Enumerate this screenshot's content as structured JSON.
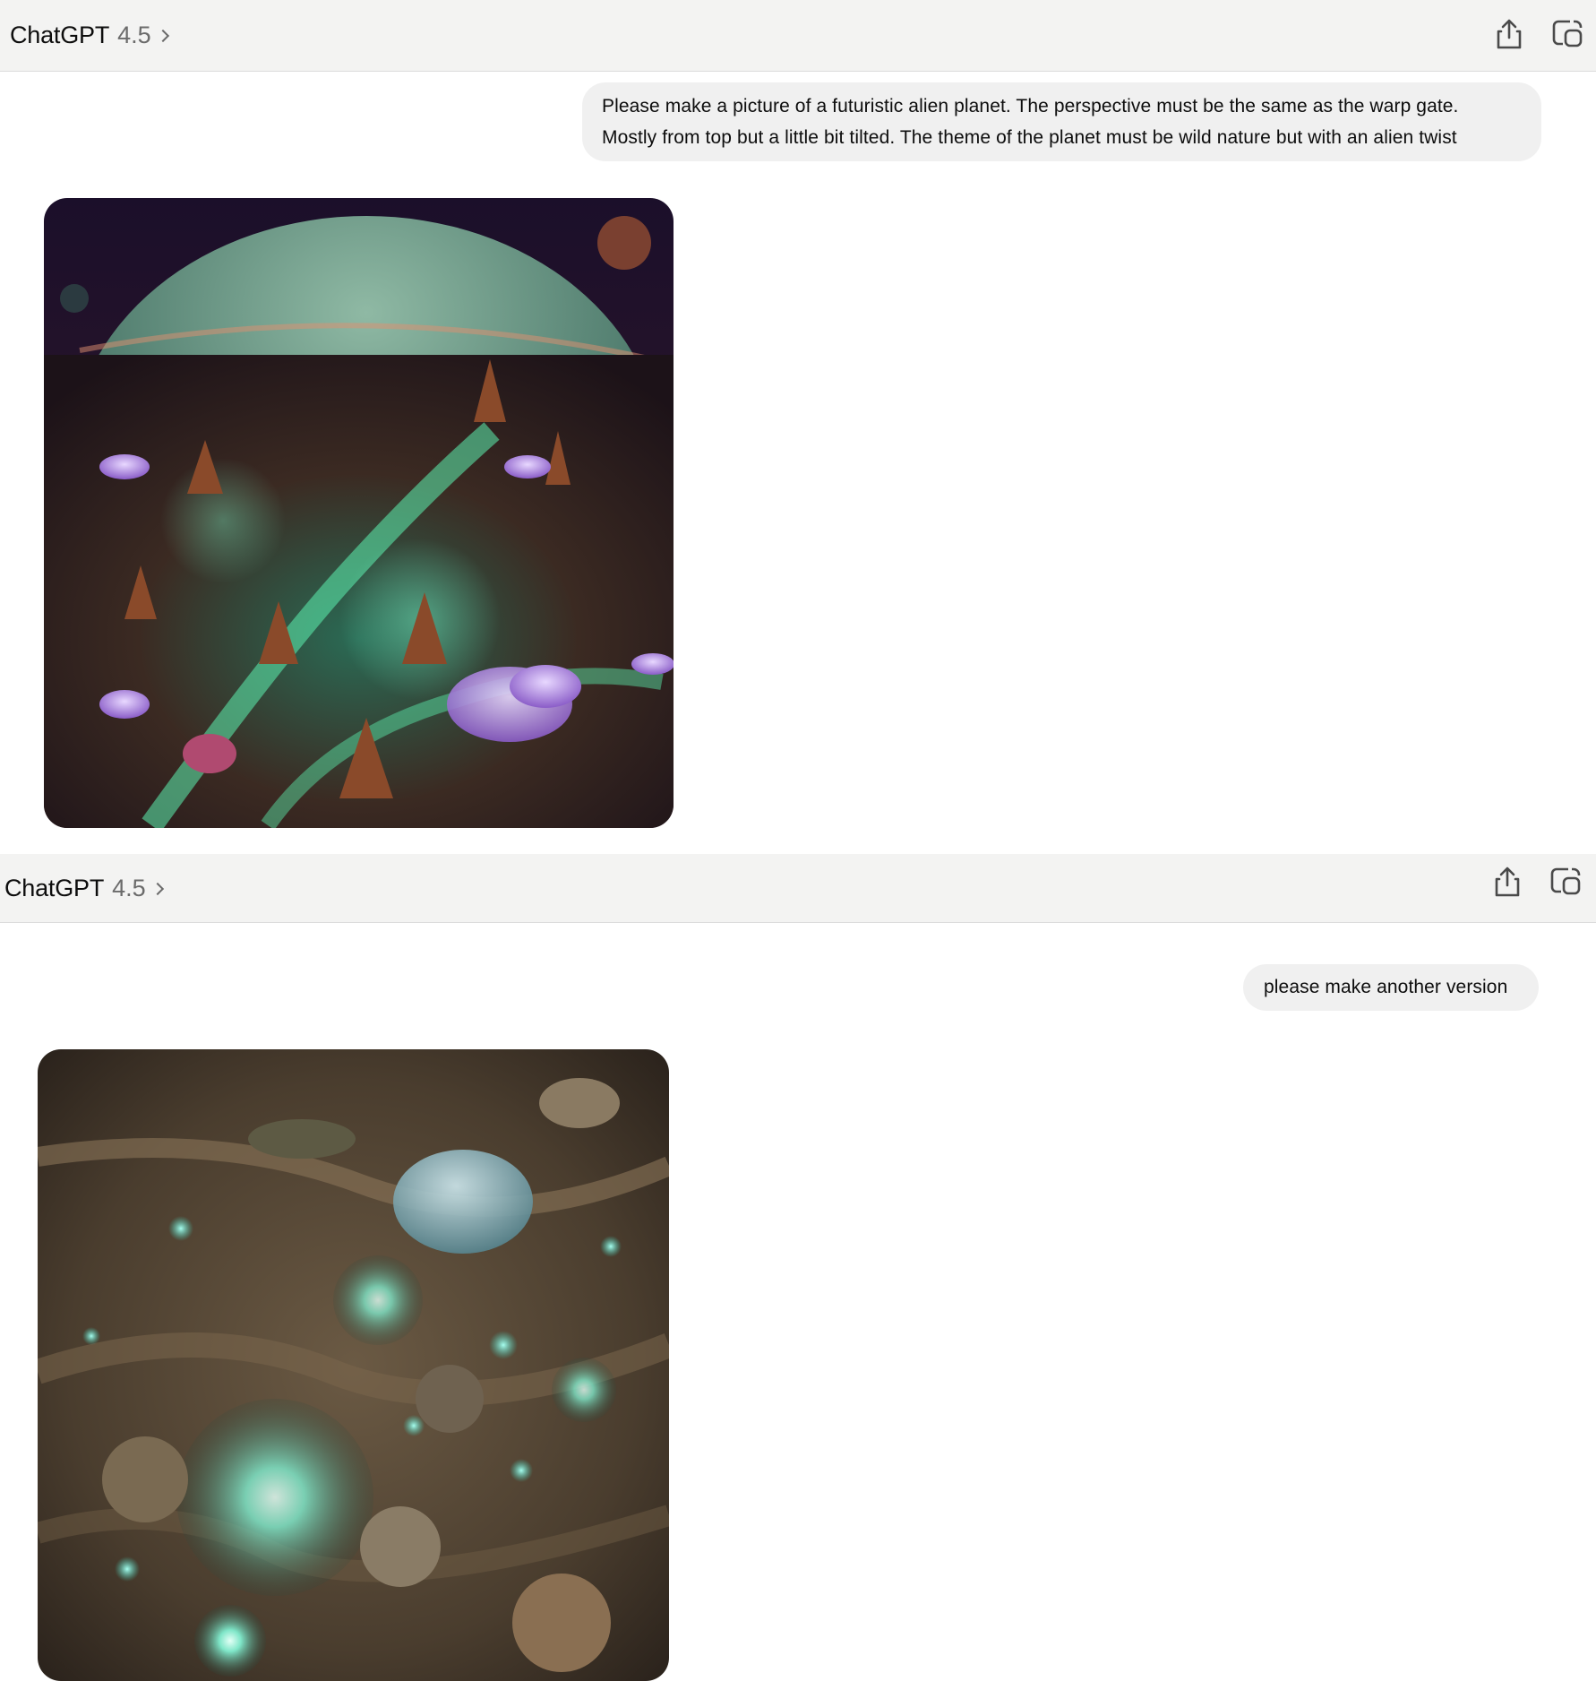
{
  "headers": [
    {
      "app_name": "ChatGPT",
      "model_version": "4.5"
    },
    {
      "app_name": "ChatGPT",
      "model_version": "4.5"
    }
  ],
  "icons": {
    "share": "share-icon",
    "new_chat": "new-chat-icon",
    "chevron": "chevron-right-icon"
  },
  "messages": [
    {
      "role": "user",
      "lines": [
        "Please make a picture of a futuristic alien planet. The perspective must be the same as the warp gate.",
        "Mostly from top but a little bit tilted. The theme of the planet must be wild nature but with an alien twist"
      ]
    },
    {
      "role": "user",
      "text": "please make another version"
    }
  ],
  "colors": {
    "header_bg": "#f3f3f2",
    "bubble_bg": "#f0f0f0",
    "text": "#0d0d0d",
    "muted": "#6b6b6b"
  }
}
